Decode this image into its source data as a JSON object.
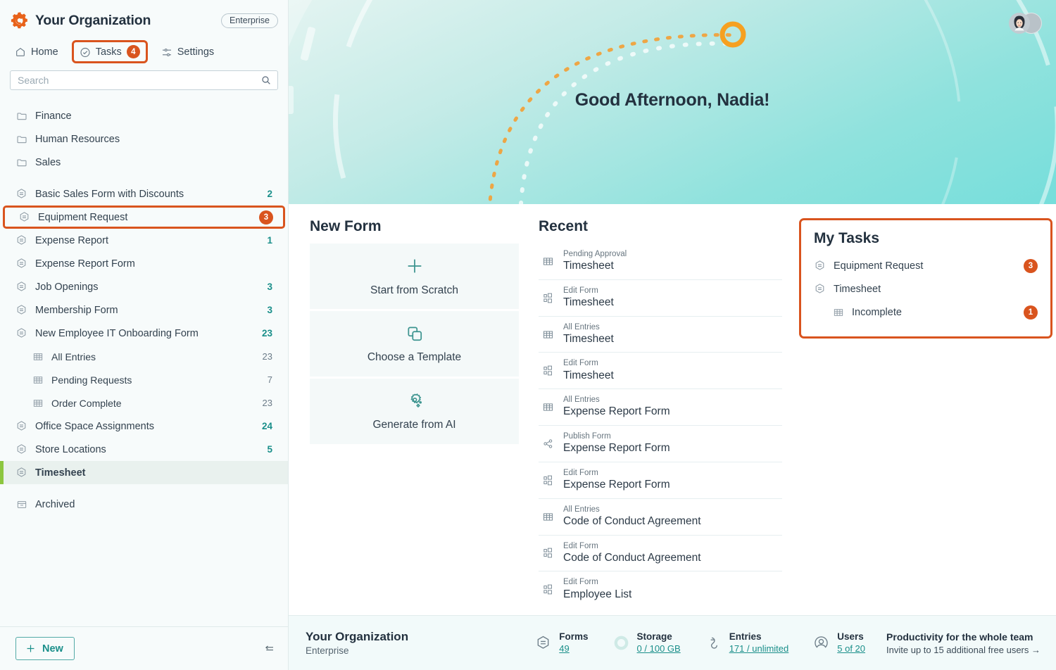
{
  "sidebar": {
    "org_title": "Your Organization",
    "plan_badge": "Enterprise",
    "logo_icon": "gear-logo-icon",
    "nav": [
      {
        "label": "Home",
        "icon": "home-icon",
        "badge": ""
      },
      {
        "label": "Tasks",
        "icon": "check-circle-icon",
        "badge": "4"
      },
      {
        "label": "Settings",
        "icon": "sliders-icon",
        "badge": ""
      }
    ],
    "search": {
      "placeholder": "Search",
      "value": "",
      "icon": "search-icon"
    },
    "folders": [
      {
        "label": "Finance",
        "icon": "folder-icon"
      },
      {
        "label": "Human Resources",
        "icon": "folder-icon"
      },
      {
        "label": "Sales",
        "icon": "folder-icon"
      }
    ],
    "forms": [
      {
        "label": "Basic Sales Form with Discounts",
        "count": "2",
        "icon": "form-icon"
      },
      {
        "label": "Equipment Request",
        "count": "3",
        "icon": "form-icon",
        "highlighted": true
      },
      {
        "label": "Expense Report",
        "count": "1",
        "icon": "form-icon"
      },
      {
        "label": "Expense Report Form",
        "count": "",
        "icon": "form-icon"
      },
      {
        "label": "Job Openings",
        "count": "3",
        "icon": "form-icon"
      },
      {
        "label": "Membership Form",
        "count": "3",
        "icon": "form-icon"
      },
      {
        "label": "New Employee IT Onboarding Form",
        "count": "23",
        "icon": "form-icon"
      }
    ],
    "subviews": [
      {
        "label": "All Entries",
        "count": "23",
        "icon": "table-icon"
      },
      {
        "label": "Pending Requests",
        "count": "7",
        "icon": "table-icon"
      },
      {
        "label": "Order Complete",
        "count": "23",
        "icon": "table-icon"
      }
    ],
    "forms_after": [
      {
        "label": "Office Space Assignments",
        "count": "24",
        "icon": "form-icon"
      },
      {
        "label": "Store Locations",
        "count": "5",
        "icon": "form-icon"
      },
      {
        "label": "Timesheet",
        "count": "",
        "icon": "form-icon",
        "active": true
      }
    ],
    "archived": {
      "label": "Archived",
      "icon": "archive-icon"
    },
    "new_button": {
      "label": "New",
      "icon": "plus-icon"
    },
    "collapse_icon": "collapse-sidebar-icon"
  },
  "hero": {
    "greeting": "Good Afternoon, Nadia!",
    "help_icon": "help-circle-icon",
    "avatar_icon": "user-avatar",
    "gradient_from": "#e3f4f1",
    "gradient_to": "#76dedb",
    "accent_orange": "#f5a623"
  },
  "main": {
    "new_form": {
      "title": "New Form",
      "cards": [
        {
          "label": "Start from Scratch",
          "icon": "plus-icon"
        },
        {
          "label": "Choose a Template",
          "icon": "copy-icon"
        },
        {
          "label": "Generate from AI",
          "icon": "ai-gear-icon"
        }
      ]
    },
    "recent": {
      "title": "Recent",
      "items": [
        {
          "kind": "Pending Approval",
          "name": "Timesheet",
          "icon": "table-icon"
        },
        {
          "kind": "Edit Form",
          "name": "Timesheet",
          "icon": "form-blocks-icon"
        },
        {
          "kind": "All Entries",
          "name": "Timesheet",
          "icon": "table-icon"
        },
        {
          "kind": "Edit Form",
          "name": "Timesheet",
          "icon": "form-blocks-icon"
        },
        {
          "kind": "All Entries",
          "name": "Expense Report Form",
          "icon": "table-icon"
        },
        {
          "kind": "Publish Form",
          "name": "Expense Report Form",
          "icon": "share-icon"
        },
        {
          "kind": "Edit Form",
          "name": "Expense Report Form",
          "icon": "form-blocks-icon"
        },
        {
          "kind": "All Entries",
          "name": "Code of Conduct Agreement",
          "icon": "table-icon"
        },
        {
          "kind": "Edit Form",
          "name": "Code of Conduct Agreement",
          "icon": "form-blocks-icon"
        },
        {
          "kind": "Edit Form",
          "name": "Employee List",
          "icon": "form-blocks-icon"
        }
      ]
    },
    "my_tasks": {
      "title": "My Tasks",
      "highlight_color": "#d9541e",
      "items": [
        {
          "label": "Equipment Request",
          "count": "3",
          "icon": "form-icon",
          "indent": false
        },
        {
          "label": "Timesheet",
          "count": "",
          "icon": "form-icon",
          "indent": false
        },
        {
          "label": "Incomplete",
          "count": "1",
          "icon": "table-icon",
          "indent": true
        }
      ]
    }
  },
  "footer": {
    "org_name": "Your Organization",
    "org_plan": "Enterprise",
    "stats": [
      {
        "label": "Forms",
        "value": "49",
        "icon": "form-icon"
      },
      {
        "label": "Storage",
        "value": "0 / 100 GB",
        "icon": "storage-donut-icon"
      },
      {
        "label": "Entries",
        "value": "171 / unlimited",
        "icon": "entries-icon"
      },
      {
        "label": "Users",
        "value": "5 of 20",
        "icon": "user-icon"
      }
    ],
    "promo_title": "Productivity for the whole team",
    "promo_sub": "Invite up to 15 additional free users →"
  }
}
